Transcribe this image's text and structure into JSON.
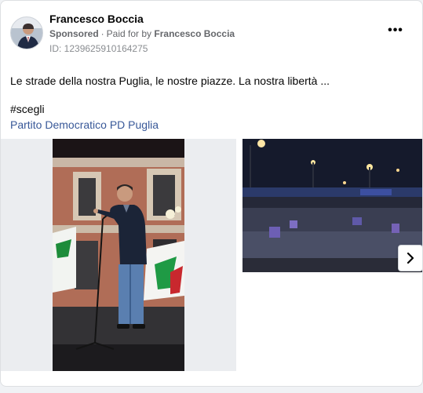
{
  "post": {
    "author": "Francesco Boccia",
    "sponsored_label": "Sponsored",
    "separator": "·",
    "paid_for_prefix": "Paid for by",
    "paid_for_by": "Francesco Boccia",
    "id_line": "ID: 1239625910164275",
    "more_icon": "more-horizontal-icon",
    "text": "Le strade della nostra Puglia, le nostre piazze. La nostra libertà ...",
    "hashtag": "#scegli",
    "page_link": "Partito Democratico PD Puglia"
  },
  "carousel": {
    "next_icon": "chevron-right-icon",
    "slides": [
      {
        "alt": "Speaker at a microphone on an outdoor stage in front of a building"
      },
      {
        "alt": "Crowd gathered in a town square at night"
      }
    ]
  },
  "colors": {
    "link": "#385898",
    "secondary_text": "#65676b",
    "border": "#dddfe2"
  }
}
